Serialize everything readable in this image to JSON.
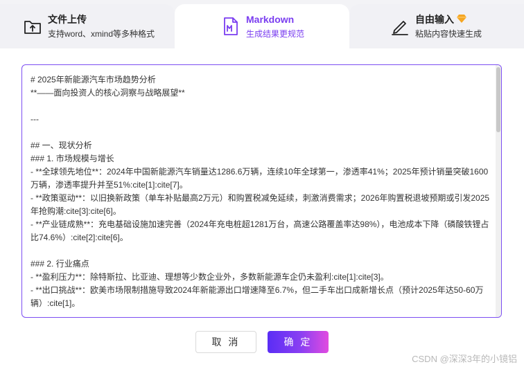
{
  "tabs": [
    {
      "title": "文件上传",
      "subtitle": "支持word、xmind等多种格式",
      "icon": "upload-file-icon",
      "active": false
    },
    {
      "title": "Markdown",
      "subtitle": "生成结果更规范",
      "icon": "markdown-file-icon",
      "active": true
    },
    {
      "title": "自由输入",
      "subtitle": "粘贴内容快速生成",
      "icon": "pen-icon",
      "badge_icon": "diamond-icon",
      "active": false
    }
  ],
  "editor": {
    "content": "# 2025年新能源汽车市场趋势分析\n**——面向投资人的核心洞察与战略展望**\n\n---\n\n## 一、现状分析\n### 1. 市场规模与增长\n- **全球领先地位**：2024年中国新能源汽车销量达1286.6万辆，连续10年全球第一，渗透率41%；2025年预计销量突破1600万辆，渗透率提升并至51%:cite[1]:cite[7]。\n- **政策驱动**：以旧换新政策（单车补贴最高2万元）和购置税减免延续，刺激消费需求；2026年购置税退坡预期或引发2025年抢购潮:cite[3]:cite[6]。\n- **产业链成熟**：充电基础设施加速完善（2024年充电桩超1281万台，高速公路覆盖率达98%），电池成本下降（磷酸铁锂占比74.6%）:cite[2]:cite[6]。\n\n### 2. 行业痛点\n- **盈利压力**：除特斯拉、比亚迪、理想等少数企业外，多数新能源车企仍未盈利:cite[1]:cite[3]。\n- **出口挑战**：欧美市场限制措施导致2024年新能源出口增速降至6.7%，但二手车出口成新增长点（预计2025年达50-60万辆）:cite[1]。"
  },
  "buttons": {
    "cancel": "取 消",
    "confirm": "确 定"
  },
  "watermark": "CSDN @深深3年的小镜铝",
  "colors": {
    "accent": "#7a3df0",
    "gradient_start": "#5a2df5",
    "gradient_end": "#e14be0",
    "badge": "#f5a623"
  }
}
